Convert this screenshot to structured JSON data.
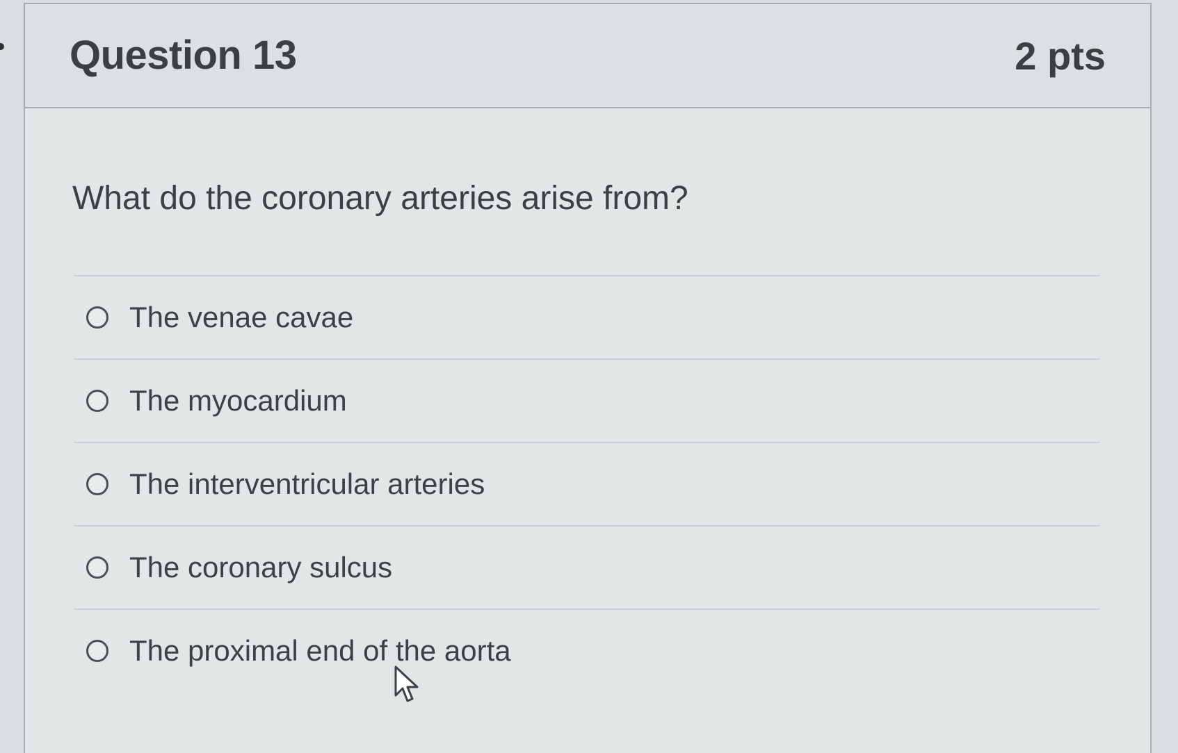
{
  "question": {
    "title": "Question 13",
    "points": "2 pts",
    "text": "What do the coronary arteries arise from?"
  },
  "answers": [
    {
      "label": "The venae cavae",
      "selected": false
    },
    {
      "label": "The myocardium",
      "selected": false
    },
    {
      "label": "The interventricular arteries",
      "selected": false
    },
    {
      "label": "The coronary sulcus",
      "selected": false
    },
    {
      "label": "The proximal end of the aorta",
      "selected": false
    }
  ],
  "icons": {
    "radio": "radio-unselected-icon",
    "cursor": "mouse-pointer-icon"
  },
  "colors": {
    "background": "#d9dfe0",
    "card": "#e1e6e7",
    "text": "#3a3f43",
    "border": "#a7aeb2"
  }
}
